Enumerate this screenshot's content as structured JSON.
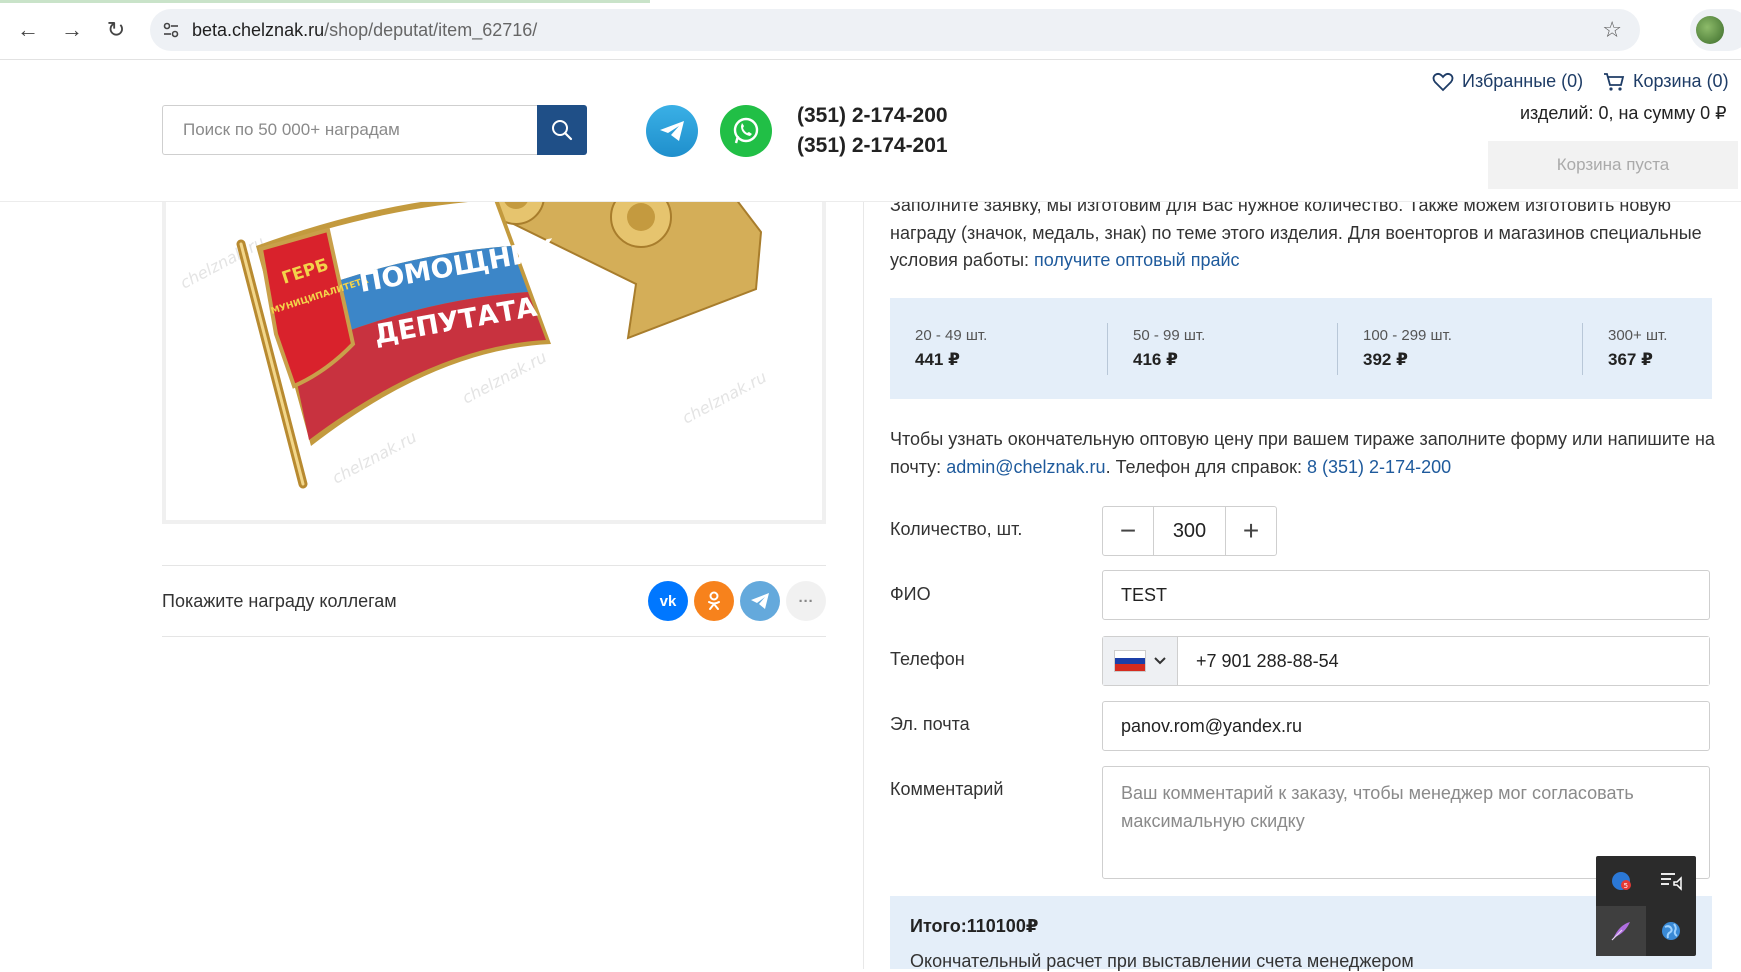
{
  "browser": {
    "url_host": "beta.chelznak.ru",
    "url_path": "/shop/deputat/item_62716/"
  },
  "header": {
    "search_placeholder": "Поиск по 50 000+ наградам",
    "phone1": "(351) 2-174-200",
    "phone2": "(351) 2-174-201",
    "favorites": "Избранные (0)",
    "cart": "Корзина (0)",
    "cart_summary": "изделий: 0, на сумму 0 ₽",
    "cart_empty_button": "Корзина пуста"
  },
  "product": {
    "badge_line1": "ГЕРБ",
    "badge_line2": "МУНИЦИПАЛИТЕТА",
    "banner_top": "ПОМОЩНИК",
    "banner_bottom": "ДЕПУТАТА",
    "watermark": "chelznak.ru"
  },
  "share": {
    "label": "Покажите награду коллегам",
    "vk": "vk",
    "more": "···"
  },
  "intro": {
    "text": "Заполните заявку, мы изготовим для Вас нужное количество. Также можем изготовить новую награду (значок, медаль, знак) по теме этого изделия. Для военторгов и магазинов специальные условия работы: ",
    "link": "получите оптовый прайс"
  },
  "prices": [
    {
      "range": "20 - 49 шт.",
      "price": "441 ₽"
    },
    {
      "range": "50 - 99 шт.",
      "price": "416 ₽"
    },
    {
      "range": "100 - 299 шт.",
      "price": "392 ₽"
    },
    {
      "range": "300+ шт.",
      "price": "367 ₽"
    }
  ],
  "note": {
    "text1": "Чтобы узнать окончательную оптовую цену при вашем тираже заполните форму или напишите на почту: ",
    "email": "admin@chelznak.ru",
    "text2": ". Телефон для справок: ",
    "phone": "8 (351) 2-174-200"
  },
  "form": {
    "qty_label": "Количество, шт.",
    "qty_value": "300",
    "name_label": "ФИО",
    "name_value": "TEST",
    "phone_label": "Телефон",
    "phone_value": "+7 901 288-88-54",
    "email_label": "Эл. почта",
    "email_value": "panov.rom@yandex.ru",
    "comment_label": "Комментарий",
    "comment_placeholder": "Ваш комментарий к заказу, чтобы менеджер мог согласовать максимальную скидку"
  },
  "total": {
    "text": "Итого:110100₽",
    "note": "Окончательный расчет при выставлении счета менеджером"
  },
  "tray": {
    "badge_count": "5"
  },
  "colors": {
    "accent": "#1f4f87",
    "link": "#1e5a9c",
    "price_bg": "#e4eef9"
  }
}
